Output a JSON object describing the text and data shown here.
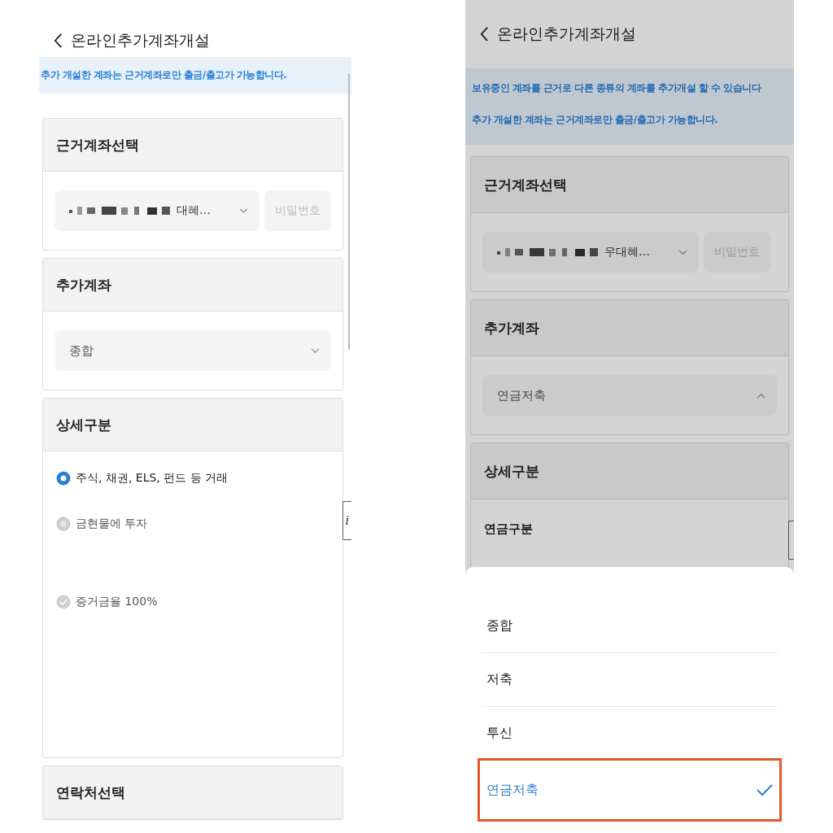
{
  "screens": [
    {
      "title": "온라인추가계좌개설",
      "notice": [
        "추가 개설한 계좌는 근거계좌로만 출금/출고가 가능합니다."
      ],
      "dimmed": false,
      "info_tab": "i",
      "sections": [
        {
          "title": "근거계좌선택",
          "kind": "account",
          "value": "대혜…",
          "password_placeholder": "비밀번호"
        },
        {
          "title": "추가계좌",
          "kind": "select",
          "value": "종합",
          "expanded": false
        },
        {
          "title": "상세구분",
          "kind": "options",
          "options": [
            {
              "kind": "radio",
              "label": "주식, 채권, ELS, 펀드 등 거래",
              "selected": true,
              "disabled": false
            },
            {
              "kind": "radio",
              "label": "금현물에 투자",
              "selected": false,
              "disabled": true
            },
            {
              "kind": "check",
              "label": "증거금율 100%",
              "selected": false,
              "disabled": true
            }
          ]
        },
        {
          "title": "연락처선택",
          "kind": "none"
        }
      ]
    },
    {
      "title": "온라인추가계좌개설",
      "notice": [
        "보유중인 계좌를 근거로 다른 종류의 계좌를 추가개설 할 수 있습니다",
        "추가 개설한 계좌는 근거계좌로만 출금/출고가 가능합니다."
      ],
      "dimmed": true,
      "sections": [
        {
          "title": "근거계좌선택",
          "kind": "account",
          "value": "우대혜…",
          "password_placeholder": "비밀번호"
        },
        {
          "title": "추가계좌",
          "kind": "select",
          "value": "연금저축",
          "expanded": true
        },
        {
          "title": "상세구분",
          "kind": "subtitle",
          "subtitle": "연금구분"
        }
      ],
      "sheet": {
        "items": [
          {
            "label": "종합",
            "selected": false,
            "outlined": false
          },
          {
            "label": "저축",
            "selected": false,
            "outlined": false
          },
          {
            "label": "투신",
            "selected": false,
            "outlined": false
          },
          {
            "label": "연금저축",
            "selected": true,
            "outlined": true
          }
        ]
      }
    }
  ]
}
